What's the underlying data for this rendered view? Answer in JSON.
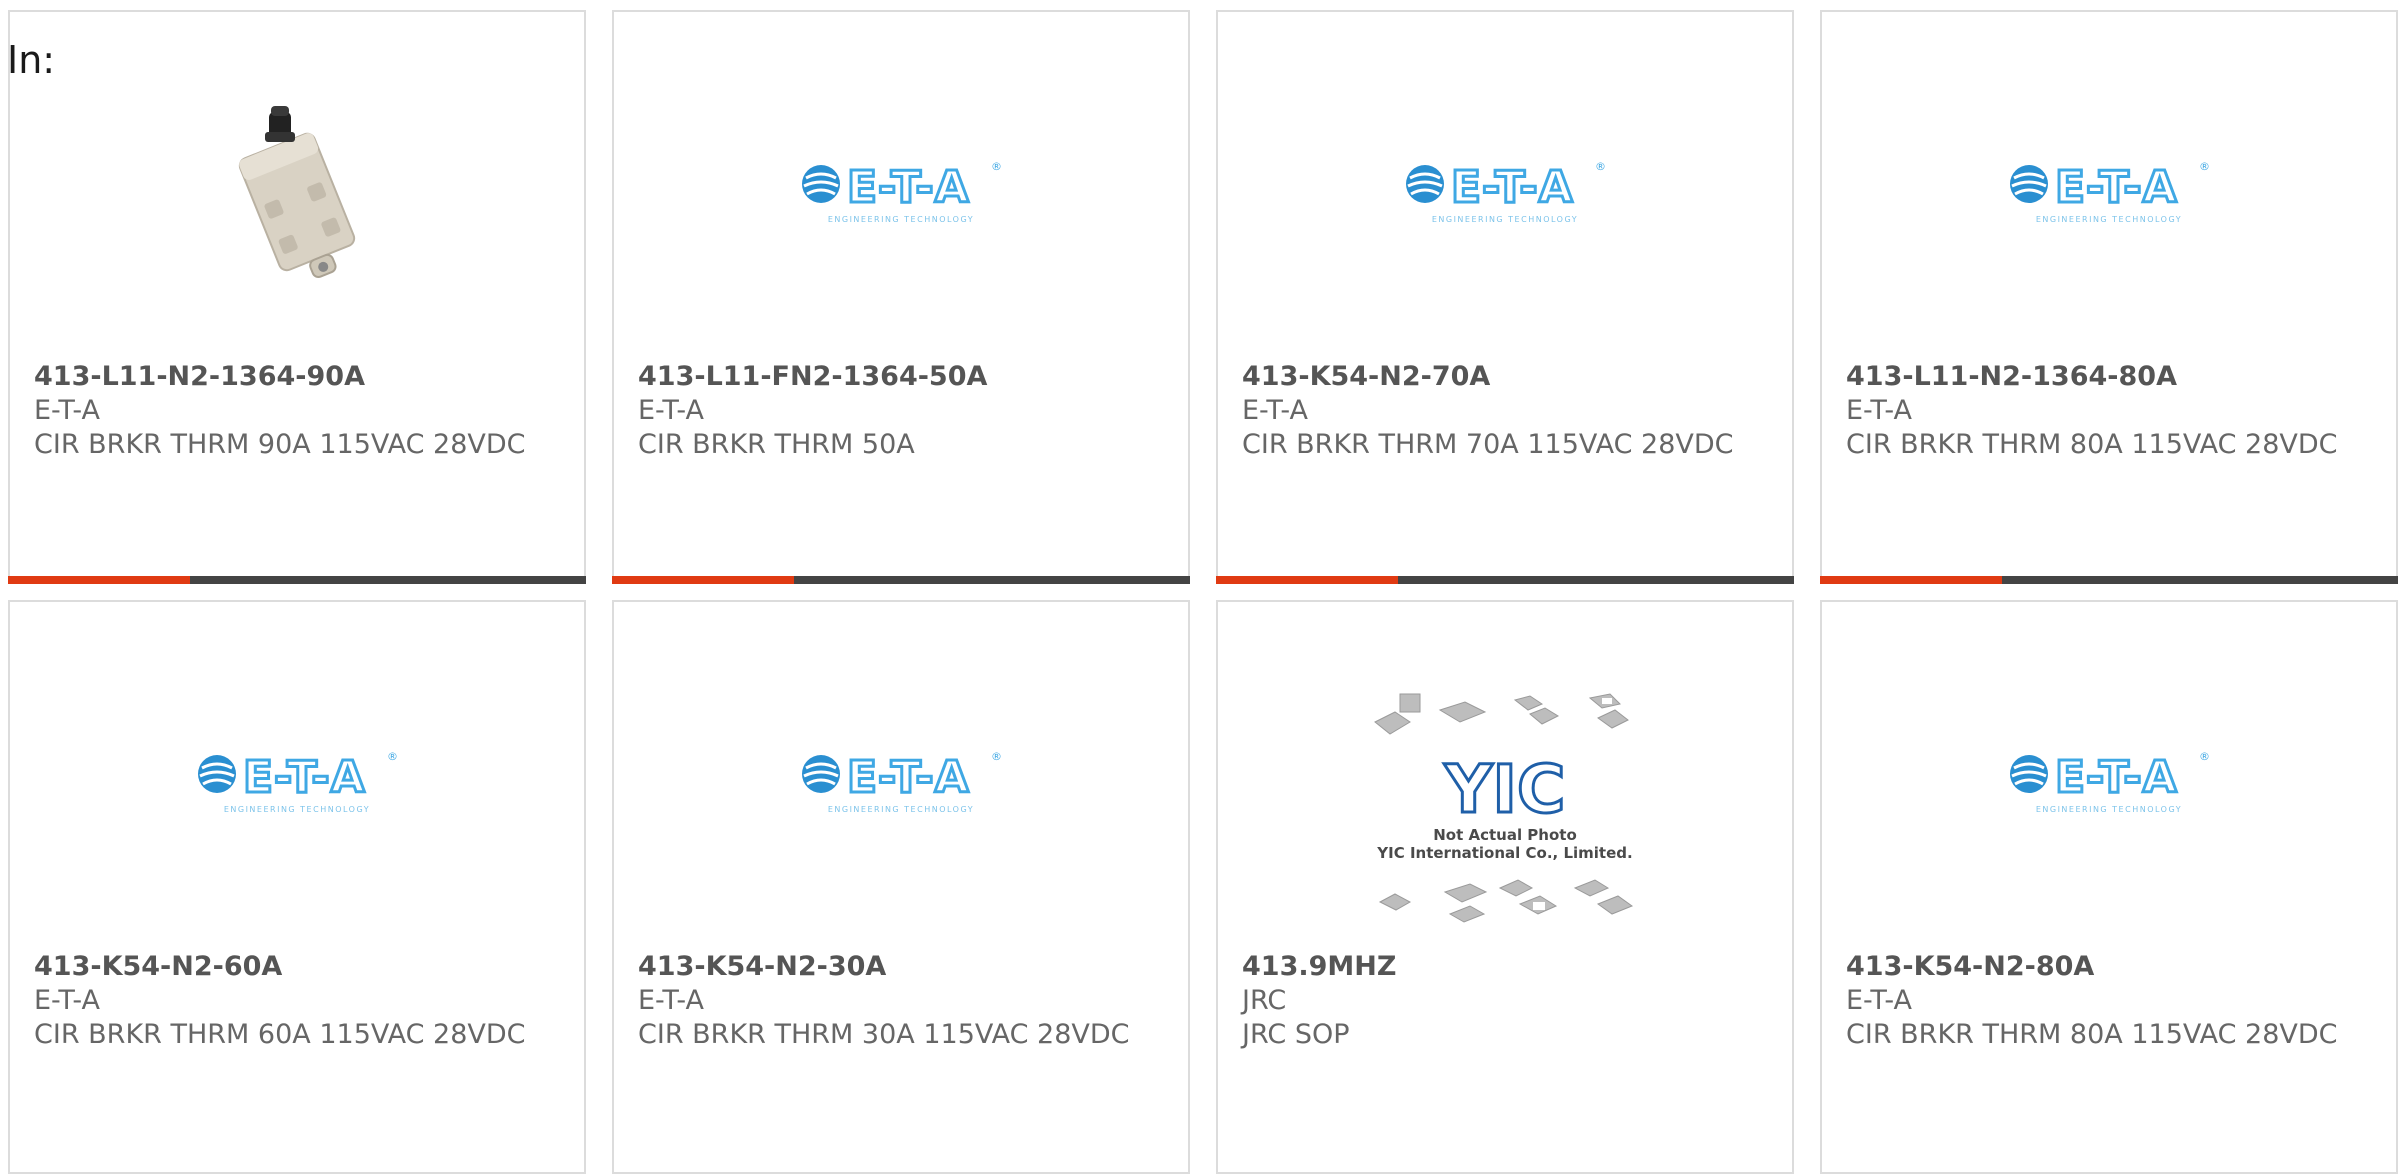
{
  "filter_label": "In:",
  "colors": {
    "accent": "#e03a12",
    "bar": "#444444",
    "border": "#dcdcdc",
    "text": "#666666"
  },
  "products": [
    {
      "part_number": "413-L11-N2-1364-90A",
      "manufacturer": "E-T-A",
      "description": "CIR BRKR THRM 90A 115VAC 28VDC",
      "image": "circuit-breaker-photo"
    },
    {
      "part_number": "413-L11-FN2-1364-50A",
      "manufacturer": "E-T-A",
      "description": "CIR BRKR THRM 50A",
      "image": "eta-logo"
    },
    {
      "part_number": "413-K54-N2-70A",
      "manufacturer": "E-T-A",
      "description": "CIR BRKR THRM 70A 115VAC 28VDC",
      "image": "eta-logo"
    },
    {
      "part_number": "413-L11-N2-1364-80A",
      "manufacturer": "E-T-A",
      "description": "CIR BRKR THRM 80A 115VAC 28VDC",
      "image": "eta-logo"
    },
    {
      "part_number": "413-K54-N2-60A",
      "manufacturer": "E-T-A",
      "description": "CIR BRKR THRM 60A 115VAC 28VDC",
      "image": "eta-logo"
    },
    {
      "part_number": "413-K54-N2-30A",
      "manufacturer": "E-T-A",
      "description": "CIR BRKR THRM 30A 115VAC 28VDC",
      "image": "eta-logo"
    },
    {
      "part_number": "413.9MHZ",
      "manufacturer": "JRC",
      "description": "JRC SOP",
      "image": "yic-placeholder"
    },
    {
      "part_number": "413-K54-N2-80A",
      "manufacturer": "E-T-A",
      "description": "CIR BRKR THRM 80A 115VAC 28VDC",
      "image": "eta-logo"
    }
  ],
  "eta_logo": {
    "wordmark": "E-T-A",
    "reg": "®",
    "tagline": "ENGINEERING TECHNOLOGY"
  },
  "yic_placeholder": {
    "logo": "YIC",
    "line1": "Not Actual Photo",
    "line2": "YIC International Co., Limited."
  }
}
